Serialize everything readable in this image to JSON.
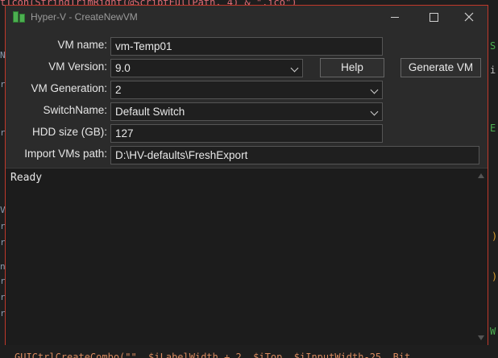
{
  "window": {
    "title": "Hyper-V - CreateNewVM",
    "colors": {
      "border": "#c0392b",
      "background": "#2b2b2b",
      "output_background": "#1c1c1c"
    }
  },
  "form": {
    "vm_name": {
      "label": "VM name:",
      "value": "vm-Temp01"
    },
    "vm_version": {
      "label": "VM Version:",
      "value": "9.0"
    },
    "vm_generation": {
      "label": "VM Generation:",
      "value": "2"
    },
    "switch_name": {
      "label": "SwitchName:",
      "value": "Default Switch"
    },
    "hdd_size": {
      "label": "HDD size (GB):",
      "value": "127"
    },
    "import_path": {
      "label": "Import VMs path:",
      "value": "D:\\HV-defaults\\FreshExport"
    }
  },
  "buttons": {
    "help": "Help",
    "generate": "Generate VM"
  },
  "output": {
    "text": "Ready"
  },
  "editor": {
    "top_line": "tIcon(StringTrimRight(@ScriptFullPath, 4) & \".ico\")",
    "bottom_line": "GUICtrlCreateCombo(\"\", $iLabelWidth + 2, $iTop, $iInputWidth-25, Bit"
  }
}
